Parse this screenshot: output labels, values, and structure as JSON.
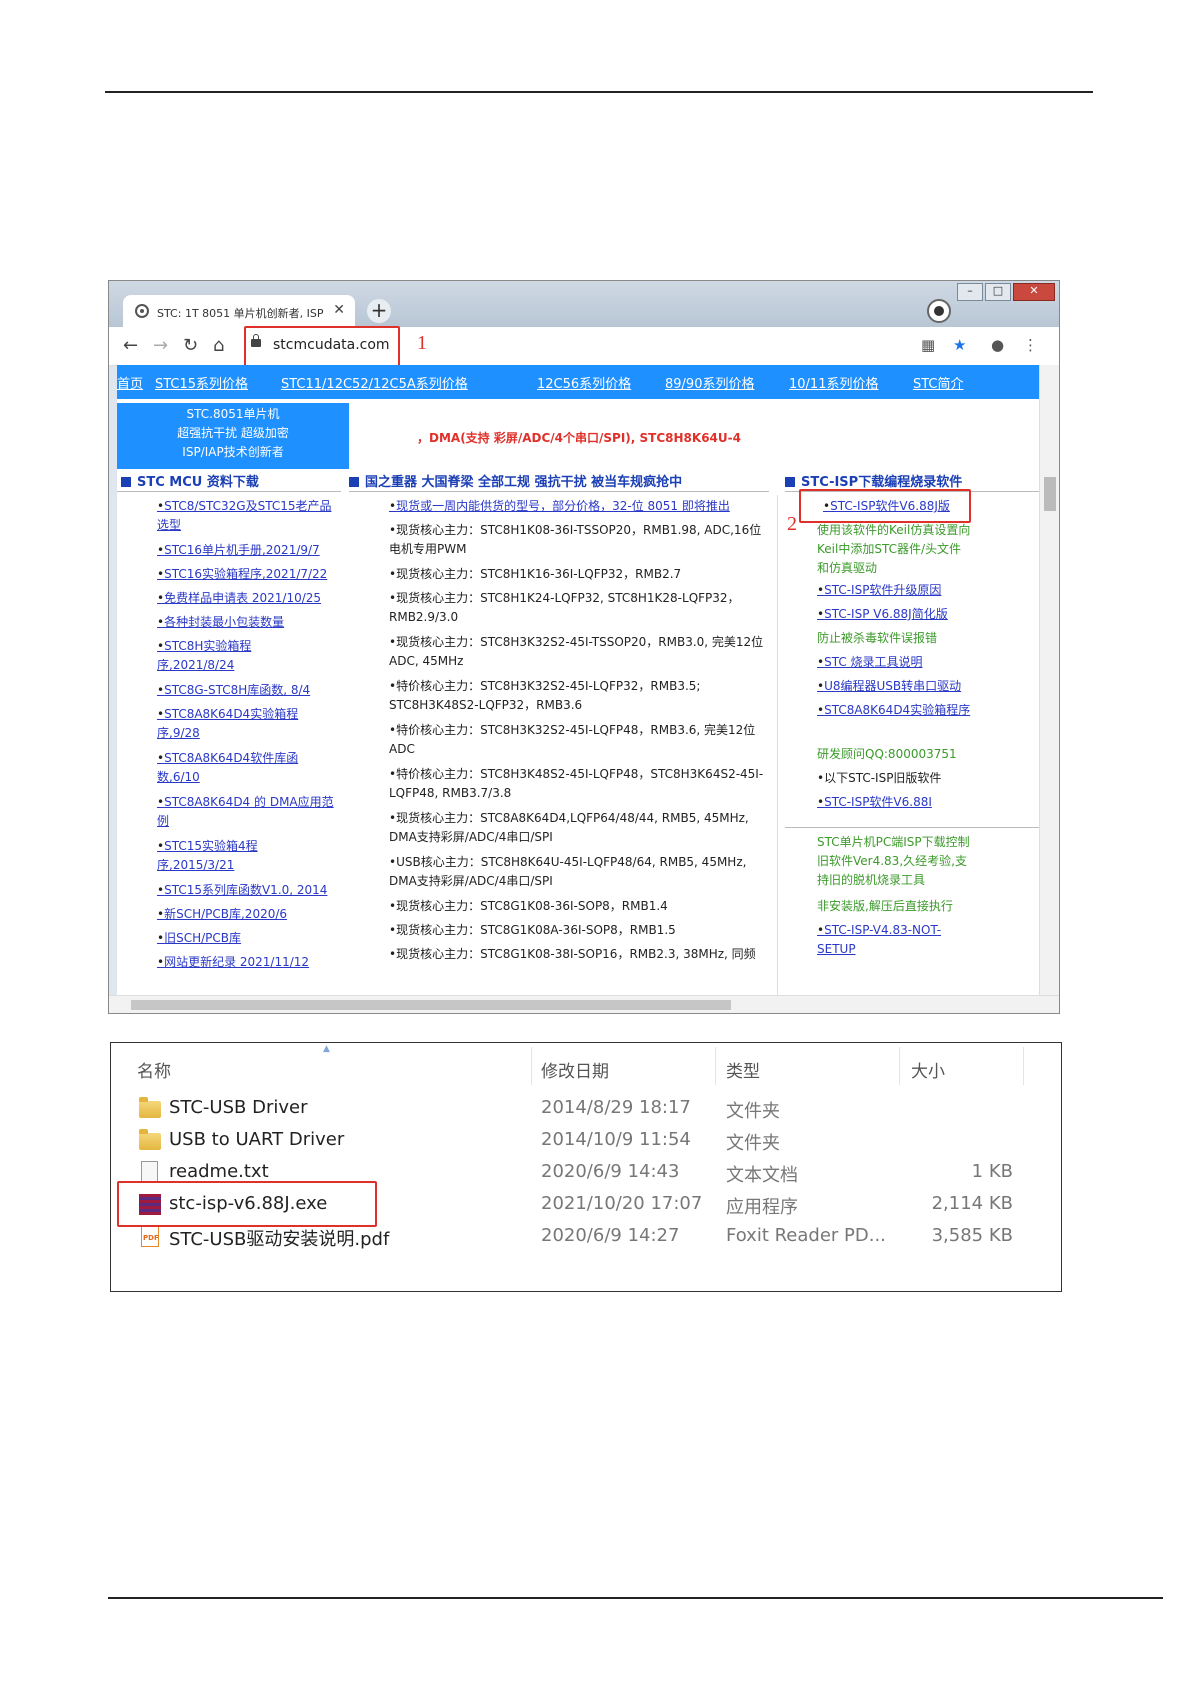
{
  "browser": {
    "tab_title": "STC: 1T 8051 单片机创新者, ISP",
    "url": "stcmcudata.com",
    "annotation_1": "1",
    "annotation_2": "2"
  },
  "site": {
    "nav": [
      "首页",
      "STC15系列价格",
      "STC11/12C52/12C5A系列价格",
      "12C56系列价格",
      "89/90系列价格",
      "10/11系列价格",
      "STC简介"
    ],
    "banner_lines": [
      "STC.8051单片机",
      "超强抗干扰 超级加密",
      "ISP/IAP技术创新者"
    ],
    "promo": "，DMA(支持 彩屏/ADC/4个串口/SPI), STC8H8K64U-4",
    "col1_title": "STC MCU 资料下载",
    "col2_title": "国之重器 大国脊梁 全部工规 强抗干扰 被当车规疯抢中",
    "col3_title": "STC-ISP下载编程烧录软件",
    "col1_items": [
      "STC8/STC32G及STC15老产品选型",
      "STC16单片机手册,2021/9/7",
      "STC16实验箱程序,2021/7/22",
      "免费样品申请表 2021/10/25",
      "各种封装最小包装数量",
      "STC8H实验箱程序,2021/8/24",
      "STC8G-STC8H库函数, 8/4",
      "STC8A8K64D4实验箱程序,9/28",
      "STC8A8K64D4软件库函数,6/10",
      "STC8A8K64D4 的 DMA应用范例",
      "STC15实验箱4程序,2015/3/21",
      "STC15系列库函数V1.0, 2014",
      "新SCH/PCB库,2020/6",
      "旧SCH/PCB库",
      "网站更新纪录 2021/11/12"
    ],
    "col2_first": "现货或一周内能供货的型号，部分价格，32-位 8051 即将推出",
    "col2_items": [
      "现货核心主力：STC8H1K08-36I-TSSOP20，RMB1.98, ADC,16位电机专用PWM",
      "现货核心主力：STC8H1K16-36I-LQFP32，RMB2.7",
      "现货核心主力：STC8H1K24-LQFP32, STC8H1K28-LQFP32，RMB2.9/3.0",
      "现货核心主力：STC8H3K32S2-45I-TSSOP20，RMB3.0, 完美12位ADC, 45MHz",
      "特价核心主力：STC8H3K32S2-45I-LQFP32，RMB3.5; STC8H3K48S2-LQFP32，RMB3.6",
      "特价核心主力：STC8H3K32S2-45I-LQFP48，RMB3.6, 完美12位ADC",
      "特价核心主力：STC8H3K48S2-45I-LQFP48，STC8H3K64S2-45I-LQFP48, RMB3.7/3.8",
      "现货核心主力：STC8A8K64D4,LQFP64/48/44, RMB5, 45MHz, DMA支持彩屏/ADC/4串口/SPI",
      "USB核心主力：STC8H8K64U-45I-LQFP48/64, RMB5, 45MHz, DMA支持彩屏/ADC/4串口/SPI",
      "现货核心主力：STC8G1K08-36I-SOP8，RMB1.4",
      "现货核心主力：STC8G1K08A-36I-SOP8，RMB1.5",
      "现货核心主力：STC8G1K08-38I-SOP16，RMB2.3, 38MHz, 同频"
    ],
    "col3": {
      "link_isp_688j": "STC-ISP软件V6.88J版",
      "note_keil": "使用该软件的Keil仿真设置向Keil中添加STC器件/头文件和仿真驱动",
      "link_upgrade": "STC-ISP软件升级原因",
      "link_simplified": "STC-ISP V6.88J简化版",
      "note_antivirus": "防止被杀毒软件误报错",
      "link_tool": "STC 烧录工具说明",
      "link_u8": "U8编程器USB转串口驱动",
      "link_exp": "STC8A8K64D4实验箱程序",
      "note_qq": "研发顾问QQ:800003751",
      "note_old": "以下STC-ISP旧版软件",
      "link_688i": "STC-ISP软件V6.88I",
      "note_pc": "STC单片机PC端ISP下载控制旧软件Ver4.83,久经考验,支持旧的脱机烧录工具",
      "note_portable": "非安装版,解压后直接执行",
      "link_483": "STC-ISP-V4.83-NOT-SETUP"
    }
  },
  "explorer": {
    "headers": [
      "名称",
      "修改日期",
      "类型",
      "大小"
    ],
    "rows": [
      {
        "icon": "folder-icon",
        "name": "STC-USB Driver",
        "date": "2014/8/29 18:17",
        "type": "文件夹",
        "size": ""
      },
      {
        "icon": "folder-icon",
        "name": "USB to UART Driver",
        "date": "2014/10/9 11:54",
        "type": "文件夹",
        "size": ""
      },
      {
        "icon": "text-file-icon",
        "name": "readme.txt",
        "date": "2020/6/9 14:43",
        "type": "文本文档",
        "size": "1 KB"
      },
      {
        "icon": "exe-icon",
        "name": "stc-isp-v6.88J.exe",
        "date": "2021/10/20 17:07",
        "type": "应用程序",
        "size": "2,114 KB"
      },
      {
        "icon": "pdf-icon",
        "name": "STC-USB驱动安装说明.pdf",
        "date": "2020/6/9 14:27",
        "type": "Foxit Reader PD...",
        "size": "3,585 KB"
      }
    ]
  },
  "colors": {
    "accent": "#1e90ff",
    "highlight": "#e0302a",
    "link": "#2a38c6",
    "note": "#3b9a2a"
  }
}
